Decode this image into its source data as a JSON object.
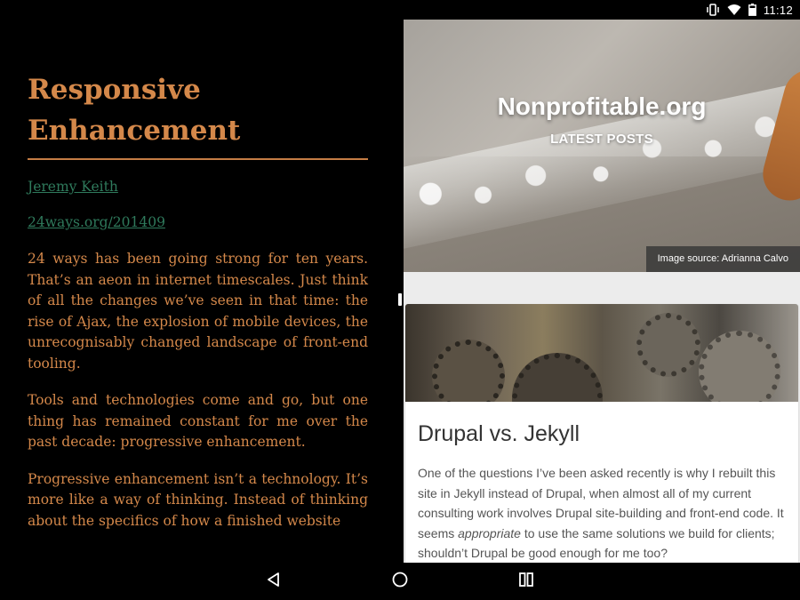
{
  "status": {
    "time": "11:12",
    "icons": [
      "vibrate-icon",
      "wifi-icon",
      "battery-icon"
    ]
  },
  "left": {
    "title": "Responsive Enhancement",
    "author_link": "Jeremy Keith",
    "source_link": "24ways.org/201409",
    "paragraphs": [
      "24 ways has been going strong for ten years. That’s an aeon in internet timescales. Just think of all the changes we’ve seen in that time: the rise of Ajax, the explosion of mobile devices, the unrecognisably changed landscape of front-end tooling.",
      "Tools and technologies come and go, but one thing has remained constant for me over the past decade: progressive enhancement.",
      "Progressive enhancement isn’t a technology. It’s more like a way of thinking. Instead of thinking about the specifics of how a finished website"
    ],
    "colors": {
      "text": "#d4884a",
      "link": "#2f7a5c",
      "background": "#000000"
    }
  },
  "right": {
    "site_title": "Nonprofitable.org",
    "section_label": "LATEST POSTS",
    "image_credit": "Image source: Adrianna Calvo",
    "post": {
      "title": "Drupal vs. Jekyll",
      "excerpt_before": "One of the questions I’ve been asked recently is why I rebuilt this site in Jekyll instead of Drupal, when almost all of my current consulting work involves Drupal site-building and front-end code. It seems ",
      "excerpt_em": "appropriate",
      "excerpt_after": " to use the same solutions we build for clients; shouldn’t Drupal be good enough for me too?"
    }
  },
  "nav": {
    "buttons": [
      "back-icon",
      "home-icon",
      "recents-icon"
    ]
  }
}
